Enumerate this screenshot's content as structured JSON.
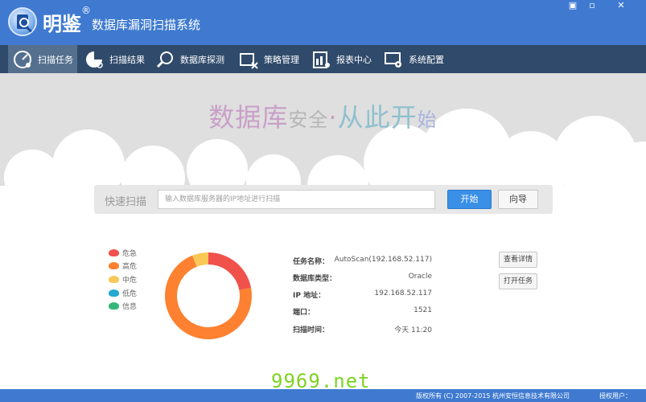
{
  "app": {
    "brand": "明鉴",
    "brand_mark": "®",
    "title": "数据库漏洞扫描系统"
  },
  "window_controls": {
    "minimize": "▣",
    "maximize": "▫",
    "close": "✕"
  },
  "tabs": [
    {
      "label": "扫描任务",
      "icon": "scan-task-icon",
      "active": true
    },
    {
      "label": "扫描结果",
      "icon": "scan-result-icon",
      "active": false
    },
    {
      "label": "数据库探测",
      "icon": "db-probe-icon",
      "active": false
    },
    {
      "label": "策略管理",
      "icon": "policy-icon",
      "active": false
    },
    {
      "label": "报表中心",
      "icon": "report-icon",
      "active": false
    },
    {
      "label": "系统配置",
      "icon": "config-icon",
      "active": false
    }
  ],
  "hero": {
    "part1": "数据库",
    "part2": "安全",
    "dot": "·",
    "part3": "从此开",
    "part4": "始"
  },
  "quick_scan": {
    "label": "快速扫描",
    "placeholder": "输入数据库服务器的IP地址进行扫描",
    "start": "开始",
    "guide": "向导"
  },
  "legend": [
    {
      "label": "危急",
      "color": "#f0524b"
    },
    {
      "label": "高危",
      "color": "#fd8130"
    },
    {
      "label": "中危",
      "color": "#f9c857"
    },
    {
      "label": "低危",
      "color": "#24a8d0"
    },
    {
      "label": "信息",
      "color": "#34b67a"
    }
  ],
  "chart_data": {
    "type": "pie",
    "donut": true,
    "categories": [
      "危急",
      "高危",
      "中危",
      "低危",
      "信息"
    ],
    "values": [
      22,
      72,
      6,
      0,
      0
    ],
    "colors": [
      "#f0524b",
      "#fd8130",
      "#f9c857",
      "#24a8d0",
      "#34b67a"
    ]
  },
  "task": {
    "name_label": "任务名称：",
    "name_value": "AutoScan(192.168.52.117)",
    "dbtype_label": "数据库类型：",
    "dbtype_value": "Oracle",
    "ip_label": "IP 地址：",
    "ip_value": "192.168.52.117",
    "port_label": "端口：",
    "port_value": "1521",
    "time_label": "扫描时间：",
    "time_value": "今天 11:20"
  },
  "actions": {
    "details": "查看详情",
    "open": "打开任务"
  },
  "watermark": "9969.net",
  "footer": {
    "copyright": "版权所有 (C) 2007-2015 杭州安恒信息技术有限公司",
    "user": "授权用户："
  }
}
